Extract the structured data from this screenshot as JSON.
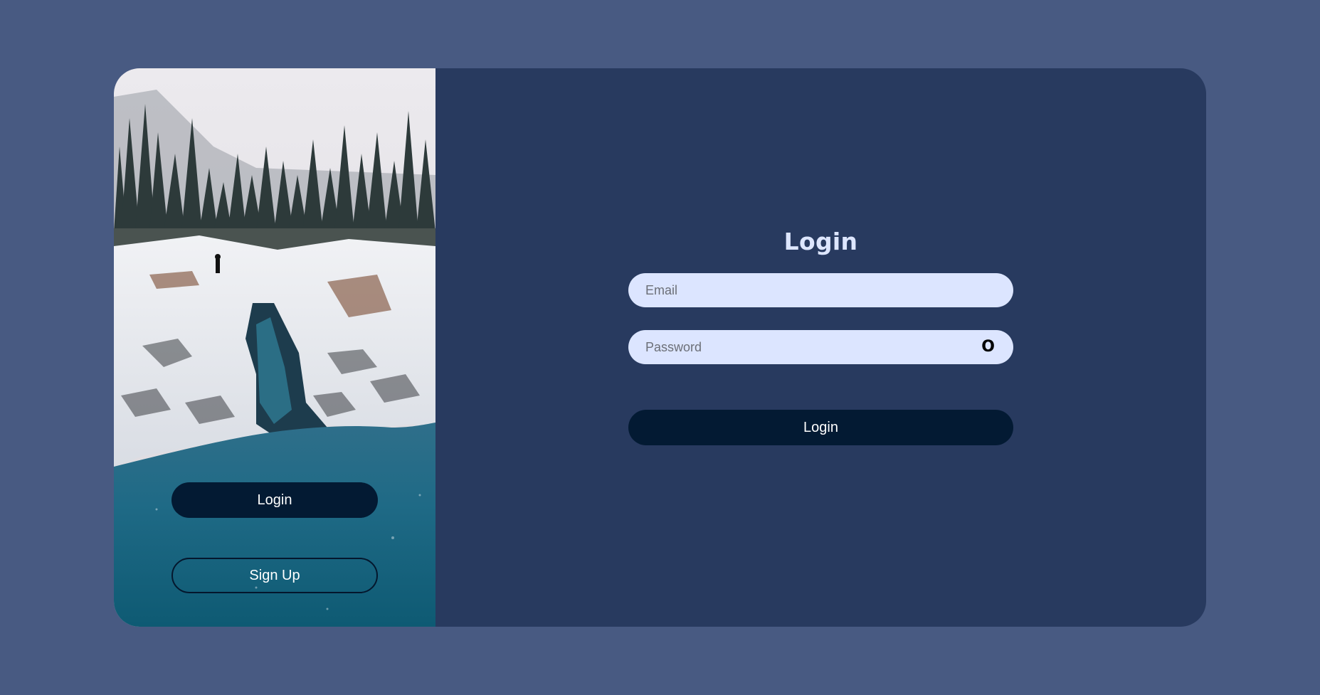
{
  "side_panel": {
    "image_description_icon": "snowy-forest-river-image",
    "login_button": "Login",
    "signup_button": "Sign Up"
  },
  "form": {
    "title": "Login",
    "email_placeholder": "Email",
    "password_placeholder": "Password",
    "password_toggle": "O",
    "submit_label": "Login"
  },
  "colors": {
    "page_background": "#485a82",
    "card_background": "#283a5f",
    "input_background": "#dce5ff",
    "button_background": "#031a33",
    "title_color": "#dde6ff"
  }
}
